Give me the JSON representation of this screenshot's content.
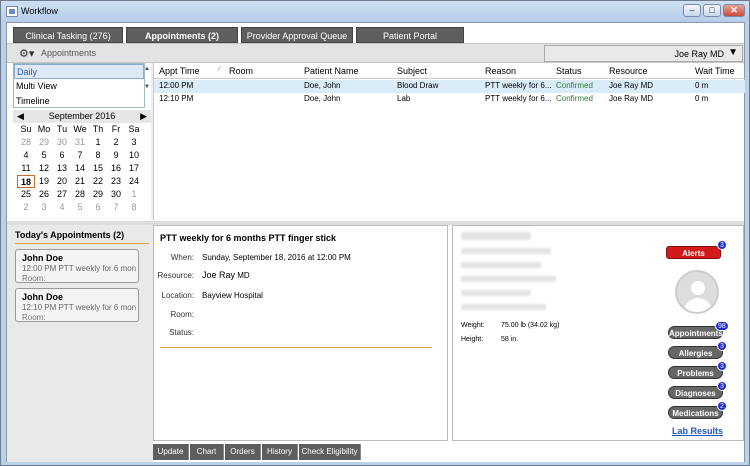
{
  "window": {
    "title": "Workflow",
    "buttons": [
      "‒",
      "□",
      "✕"
    ]
  },
  "tabs": [
    "Clinical Tasking (276)",
    "Appointments (2)",
    "Provider Approval Queue",
    "Patient Portal"
  ],
  "toolbar": {
    "section": "Appointments",
    "user": "Joe Ray MD"
  },
  "views": [
    "Daily",
    "Multi View",
    "Timeline"
  ],
  "calendar": {
    "month": "September 2016",
    "dow": [
      "Su",
      "Mo",
      "Tu",
      "We",
      "Th",
      "Fr",
      "Sa"
    ],
    "weeks": [
      [
        "28",
        "29",
        "30",
        "31",
        "1",
        "2",
        "3"
      ],
      [
        "4",
        "5",
        "6",
        "7",
        "8",
        "9",
        "10"
      ],
      [
        "11",
        "12",
        "13",
        "14",
        "15",
        "16",
        "17"
      ],
      [
        "18",
        "19",
        "20",
        "21",
        "22",
        "23",
        "24"
      ],
      [
        "25",
        "26",
        "27",
        "28",
        "29",
        "30",
        "1"
      ],
      [
        "2",
        "3",
        "4",
        "5",
        "6",
        "7",
        "8"
      ]
    ],
    "today": "18"
  },
  "grid": {
    "columns": [
      "Appt Time",
      "Room",
      "Patient Name",
      "Subject",
      "Reason",
      "Status",
      "Resource",
      "Wait Time"
    ],
    "rows": [
      [
        "12:00 PM",
        "",
        "Doe, John",
        "Blood Draw",
        "PTT weekly for 6...",
        "Confirmed",
        "Joe Ray MD",
        "0 m"
      ],
      [
        "12:10 PM",
        "",
        "Doe, John",
        "Lab",
        "PTT weekly for 6...",
        "Confirmed",
        "Joe Ray MD",
        "0 m"
      ]
    ]
  },
  "today_appts": {
    "header": "Today's Appointments (2)",
    "items": [
      {
        "name": "John Doe",
        "line": "12:00 PM PTT weekly for 6 months",
        "room": "Room:"
      },
      {
        "name": "John Doe",
        "line": "12:10 PM PTT weekly for 6 months",
        "room": "Room:"
      }
    ]
  },
  "detail": {
    "title": "PTT weekly for 6 months PTT finger stick",
    "when_label": "When:",
    "when": "Sunday, September 18, 2016 at 12:00 PM",
    "resource_label": "Resource:",
    "resource_name": "Joe Ray",
    "resource_suffix": "MD",
    "location_label": "Location:",
    "location": "Bayview Hospital",
    "room_label": "Room:",
    "status_label": "Status:"
  },
  "bottom_tabs": [
    "Update",
    "Chart",
    "Orders",
    "History",
    "Check Eligibility"
  ],
  "patient": {
    "weight_label": "Weight:",
    "weight": "75.00 lb (34.02 kg)",
    "height_label": "Height:",
    "height": "58 in.",
    "alerts": {
      "label": "Alerts",
      "count": "3"
    },
    "buttons": [
      {
        "label": "Appointments",
        "count": "98"
      },
      {
        "label": "Allergies",
        "count": "3"
      },
      {
        "label": "Problems",
        "count": "3"
      },
      {
        "label": "Diagnoses",
        "count": "3"
      },
      {
        "label": "Medications",
        "count": "2"
      }
    ],
    "lab_results": "Lab Results"
  }
}
